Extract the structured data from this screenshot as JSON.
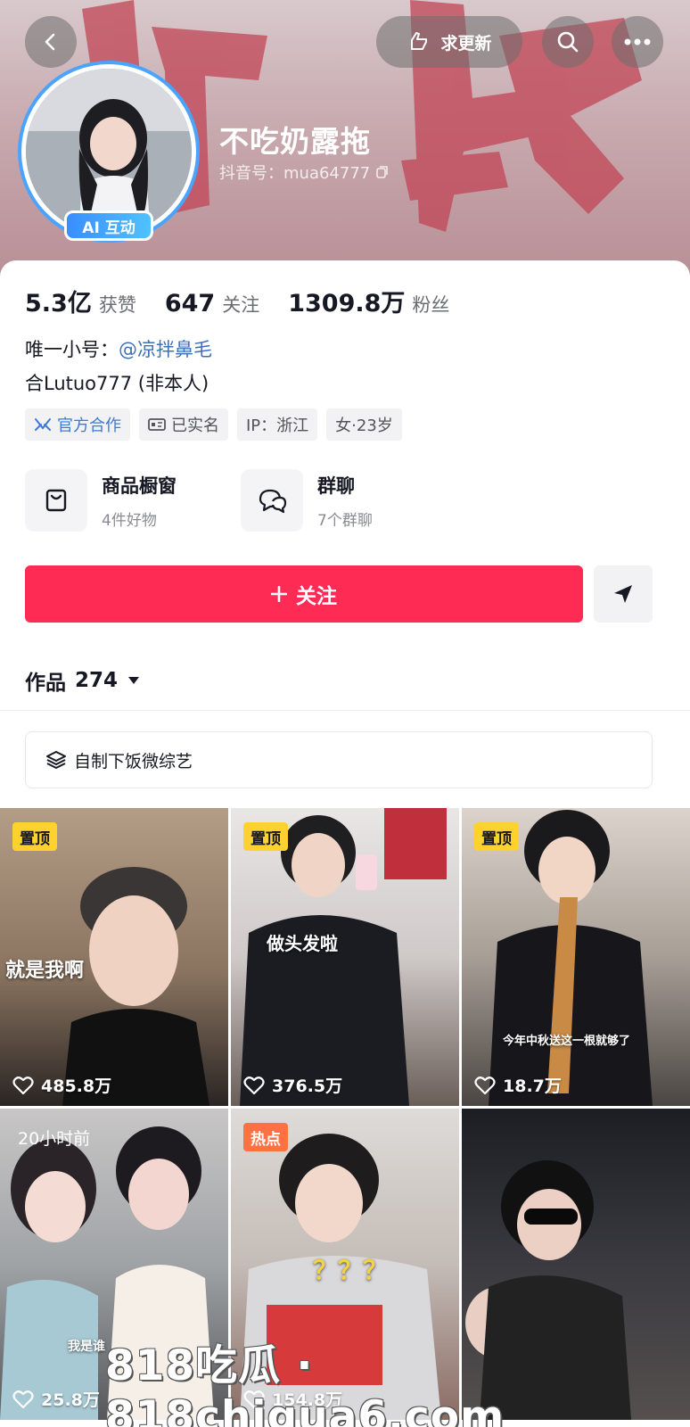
{
  "header": {
    "update_label": "求更新",
    "nickname": "不吃奶露拖",
    "douyin_id": "抖音号：mua64777",
    "ai_badge": "AI 互动"
  },
  "stats": {
    "likes_num": "5.3亿",
    "likes_label": "获赞",
    "following_num": "647",
    "following_label": "关注",
    "fans_num": "1309.8万",
    "fans_label": "粉丝"
  },
  "bio": {
    "alt_prefix": "唯一小号：",
    "alt_link": "@凉拌鼻毛",
    "line2": "合Lutuo777 (非本人)"
  },
  "tags": [
    "官方合作",
    "已实名",
    "IP：浙江",
    "女·23岁"
  ],
  "features": [
    {
      "title": "商品橱窗",
      "sub": "4件好物"
    },
    {
      "title": "群聊",
      "sub": "7个群聊"
    }
  ],
  "follow_label": "关注",
  "works": {
    "label": "作品",
    "count": "274"
  },
  "collection_label": "自制下饭微综艺",
  "videos": [
    {
      "badge": "置顶",
      "badge_type": "pin",
      "likes": "485.8万",
      "caption": "就是我啊"
    },
    {
      "badge": "置顶",
      "badge_type": "pin",
      "likes": "376.5万",
      "caption": "做头发啦"
    },
    {
      "badge": "置顶",
      "badge_type": "pin",
      "likes": "18.7万",
      "caption": "今年中秋送这一根就够了"
    },
    {
      "badge": "20小时前",
      "badge_type": "time",
      "likes": "25.8万",
      "caption": "我是谁"
    },
    {
      "badge": "热点",
      "badge_type": "hot",
      "likes": "154.8万",
      "caption": "？？？"
    },
    {
      "badge": "",
      "badge_type": "none",
      "likes": "",
      "caption": ""
    }
  ],
  "watermark": "818吃瓜 · 818chigua6.com",
  "colors": {
    "follow": "#fe2c55",
    "link": "#3f6fb5",
    "pin_badge": "#fdd22e",
    "hot_badge": "#ff7043"
  }
}
